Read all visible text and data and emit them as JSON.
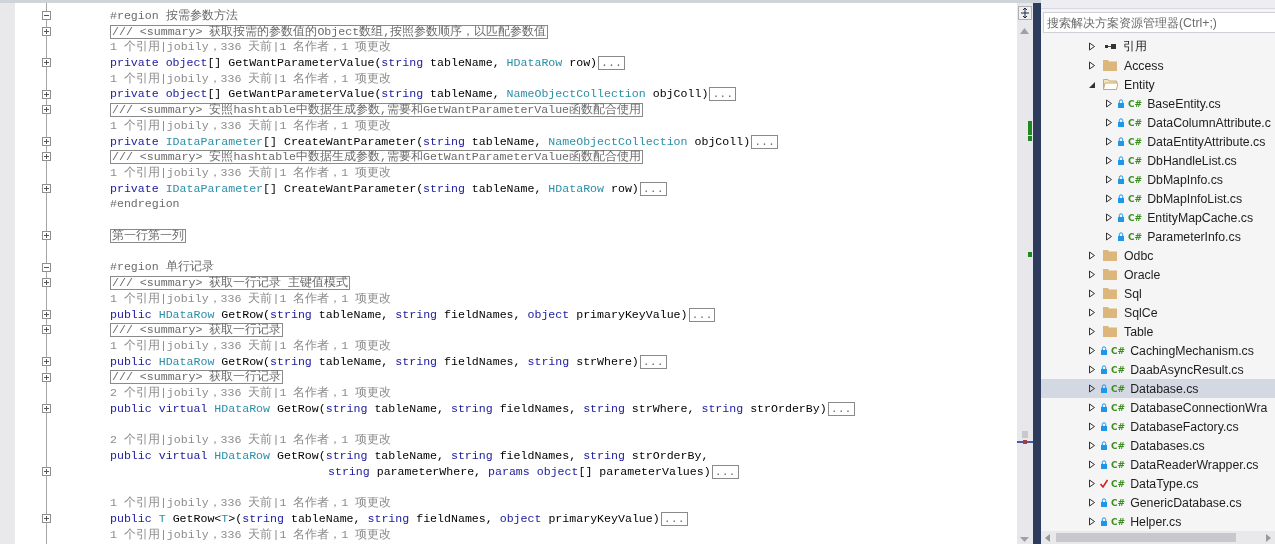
{
  "editor": {
    "lines": [
      {
        "kind": "region",
        "text": "#region 按需参数方法",
        "folded": false
      },
      {
        "kind": "summary",
        "text": "/// <summary> 获取按需的参数值的Object数组,按照参数顺序，以匹配参数值",
        "folded": true
      },
      {
        "kind": "lens",
        "text": "1 个引用|jobily，336 天前|1 名作者，1 项更改"
      },
      {
        "kind": "code",
        "folded": true,
        "ellipsis": "...",
        "tokens": [
          {
            "text": "private object",
            "kind": "keyword"
          },
          {
            "text": "[] GetWantParameterValue(",
            "kind": "plain"
          },
          {
            "text": "string",
            "kind": "keyword"
          },
          {
            "text": " tableName, ",
            "kind": "plain"
          },
          {
            "text": "HDataRow",
            "kind": "type"
          },
          {
            "text": " row)",
            "kind": "plain"
          }
        ]
      },
      {
        "kind": "lens",
        "text": "1 个引用|jobily，336 天前|1 名作者，1 项更改"
      },
      {
        "kind": "code",
        "folded": true,
        "ellipsis": "...",
        "tokens": [
          {
            "text": "private object",
            "kind": "keyword"
          },
          {
            "text": "[] GetWantParameterValue(",
            "kind": "plain"
          },
          {
            "text": "string",
            "kind": "keyword"
          },
          {
            "text": " tableName, ",
            "kind": "plain"
          },
          {
            "text": "NameObjectCollection",
            "kind": "type"
          },
          {
            "text": " objColl)",
            "kind": "plain"
          }
        ]
      },
      {
        "kind": "summary",
        "text": "/// <summary> 安照hashtable中数据生成参数,需要和GetWantParameterValue函数配合使用",
        "folded": true
      },
      {
        "kind": "lens",
        "text": "1 个引用|jobily，336 天前|1 名作者，1 项更改"
      },
      {
        "kind": "code",
        "folded": true,
        "ellipsis": "...",
        "tokens": [
          {
            "text": "private",
            "kind": "keyword"
          },
          {
            "text": " IDataParameter",
            "kind": "type"
          },
          {
            "text": "[] CreateWantParameter(",
            "kind": "plain"
          },
          {
            "text": "string",
            "kind": "keyword"
          },
          {
            "text": " tableName, ",
            "kind": "plain"
          },
          {
            "text": "NameObjectCollection",
            "kind": "type"
          },
          {
            "text": " objColl)",
            "kind": "plain"
          }
        ]
      },
      {
        "kind": "summary",
        "text": "/// <summary> 安照hashtable中数据生成参数,需要和GetWantParameterValue函数配合使用",
        "folded": true
      },
      {
        "kind": "lens",
        "text": "1 个引用|jobily，336 天前|1 名作者，1 项更改"
      },
      {
        "kind": "code",
        "folded": true,
        "ellipsis": "...",
        "tokens": [
          {
            "text": "private",
            "kind": "keyword"
          },
          {
            "text": " IDataParameter",
            "kind": "type"
          },
          {
            "text": "[] CreateWantParameter(",
            "kind": "plain"
          },
          {
            "text": "string",
            "kind": "keyword"
          },
          {
            "text": " tableName, ",
            "kind": "plain"
          },
          {
            "text": "HDataRow",
            "kind": "type"
          },
          {
            "text": " row)",
            "kind": "plain"
          }
        ]
      },
      {
        "kind": "endregion",
        "text": "#endregion"
      },
      {
        "kind": "blank"
      },
      {
        "kind": "summary",
        "text": "第一行第一列",
        "folded": true
      },
      {
        "kind": "blank"
      },
      {
        "kind": "region",
        "text": "#region 单行记录",
        "folded": false
      },
      {
        "kind": "summary",
        "text": "/// <summary> 获取一行记录 主键值模式",
        "folded": true
      },
      {
        "kind": "lens",
        "text": "1 个引用|jobily，336 天前|1 名作者，1 项更改"
      },
      {
        "kind": "code",
        "folded": true,
        "ellipsis": "...",
        "tokens": [
          {
            "text": "public",
            "kind": "keyword"
          },
          {
            "text": " HDataRow",
            "kind": "type"
          },
          {
            "text": " GetRow(",
            "kind": "plain"
          },
          {
            "text": "string",
            "kind": "keyword"
          },
          {
            "text": " tableName, ",
            "kind": "plain"
          },
          {
            "text": "string",
            "kind": "keyword"
          },
          {
            "text": " fieldNames, ",
            "kind": "plain"
          },
          {
            "text": "object",
            "kind": "keyword"
          },
          {
            "text": " primaryKeyValue)",
            "kind": "plain"
          }
        ]
      },
      {
        "kind": "summary",
        "text": "/// <summary> 获取一行记录",
        "folded": true
      },
      {
        "kind": "lens",
        "text": "1 个引用|jobily，336 天前|1 名作者，1 项更改"
      },
      {
        "kind": "code",
        "folded": true,
        "ellipsis": "...",
        "tokens": [
          {
            "text": "public",
            "kind": "keyword"
          },
          {
            "text": " HDataRow",
            "kind": "type"
          },
          {
            "text": " GetRow(",
            "kind": "plain"
          },
          {
            "text": "string",
            "kind": "keyword"
          },
          {
            "text": " tableName, ",
            "kind": "plain"
          },
          {
            "text": "string",
            "kind": "keyword"
          },
          {
            "text": " fieldNames, ",
            "kind": "plain"
          },
          {
            "text": "string",
            "kind": "keyword"
          },
          {
            "text": " strWhere)",
            "kind": "plain"
          }
        ]
      },
      {
        "kind": "summary",
        "text": "/// <summary> 获取一行记录",
        "folded": true
      },
      {
        "kind": "lens",
        "text": "2 个引用|jobily，336 天前|1 名作者，1 项更改"
      },
      {
        "kind": "code",
        "folded": true,
        "ellipsis": "...",
        "tokens": [
          {
            "text": "public virtual",
            "kind": "keyword"
          },
          {
            "text": " HDataRow",
            "kind": "type"
          },
          {
            "text": " GetRow(",
            "kind": "plain"
          },
          {
            "text": "string",
            "kind": "keyword"
          },
          {
            "text": " tableName, ",
            "kind": "plain"
          },
          {
            "text": "string",
            "kind": "keyword"
          },
          {
            "text": " fieldNames, ",
            "kind": "plain"
          },
          {
            "text": "string",
            "kind": "keyword"
          },
          {
            "text": " strWhere, ",
            "kind": "plain"
          },
          {
            "text": "string",
            "kind": "keyword"
          },
          {
            "text": " strOrderBy)",
            "kind": "plain"
          }
        ]
      },
      {
        "kind": "blank"
      },
      {
        "kind": "lens",
        "text": "2 个引用|jobily，336 天前|1 名作者，1 项更改"
      },
      {
        "kind": "code",
        "tokens": [
          {
            "text": "public virtual",
            "kind": "keyword"
          },
          {
            "text": " HDataRow",
            "kind": "type"
          },
          {
            "text": " GetRow(",
            "kind": "plain"
          },
          {
            "text": "string",
            "kind": "keyword"
          },
          {
            "text": " tableName, ",
            "kind": "plain"
          },
          {
            "text": "string",
            "kind": "keyword"
          },
          {
            "text": " fieldNames, ",
            "kind": "plain"
          },
          {
            "text": "string",
            "kind": "keyword"
          },
          {
            "text": " strOrderBy,",
            "kind": "plain"
          }
        ]
      },
      {
        "kind": "code",
        "continuation": true,
        "folded": true,
        "ellipsis": "...",
        "tokens": [
          {
            "text": "string",
            "kind": "keyword"
          },
          {
            "text": " parameterWhere, ",
            "kind": "plain"
          },
          {
            "text": "params object",
            "kind": "keyword"
          },
          {
            "text": "[] parameterValues)",
            "kind": "plain"
          }
        ]
      },
      {
        "kind": "blank"
      },
      {
        "kind": "lens",
        "text": "1 个引用|jobily，336 天前|1 名作者，1 项更改"
      },
      {
        "kind": "code",
        "folded": true,
        "ellipsis": "...",
        "tokens": [
          {
            "text": "public",
            "kind": "keyword"
          },
          {
            "text": " T",
            "kind": "type"
          },
          {
            "text": " GetRow<",
            "kind": "plain"
          },
          {
            "text": "T",
            "kind": "type"
          },
          {
            "text": ">(",
            "kind": "plain"
          },
          {
            "text": "string",
            "kind": "keyword"
          },
          {
            "text": " tableName, ",
            "kind": "plain"
          },
          {
            "text": "string",
            "kind": "keyword"
          },
          {
            "text": " fieldNames, ",
            "kind": "plain"
          },
          {
            "text": "object",
            "kind": "keyword"
          },
          {
            "text": " primaryKeyValue)",
            "kind": "plain"
          }
        ]
      },
      {
        "kind": "lens",
        "text": "1 个引用|jobily，336 天前|1 名作者，1 项更改"
      }
    ]
  },
  "solution_explorer": {
    "search": {
      "placeholder": "搜索解决方案资源管理器(Ctrl+;)"
    },
    "tree": [
      {
        "label": "引用",
        "kind": "references",
        "expanded": false,
        "selected": false
      },
      {
        "label": "Access",
        "kind": "folder",
        "expanded": false,
        "selected": false
      },
      {
        "label": "Entity",
        "kind": "folder",
        "expanded": true,
        "selected": false,
        "children": [
          {
            "label": "BaseEntity.cs",
            "kind": "csfile",
            "badge": "C#",
            "checked_out": false,
            "expanded": false,
            "selected": false
          },
          {
            "label": "DataColumnAttribute.c",
            "kind": "csfile",
            "badge": "C#",
            "checked_out": false,
            "expanded": false,
            "selected": false
          },
          {
            "label": "DataEntityAttribute.cs",
            "kind": "csfile",
            "badge": "C#",
            "checked_out": false,
            "expanded": false,
            "selected": false
          },
          {
            "label": "DbHandleList.cs",
            "kind": "csfile",
            "badge": "C#",
            "checked_out": false,
            "expanded": false,
            "selected": false
          },
          {
            "label": "DbMapInfo.cs",
            "kind": "csfile",
            "badge": "C#",
            "checked_out": false,
            "expanded": false,
            "selected": false
          },
          {
            "label": "DbMapInfoList.cs",
            "kind": "csfile",
            "badge": "C#",
            "checked_out": false,
            "expanded": false,
            "selected": false
          },
          {
            "label": "EntityMapCache.cs",
            "kind": "csfile",
            "badge": "C#",
            "checked_out": false,
            "expanded": false,
            "selected": false
          },
          {
            "label": "ParameterInfo.cs",
            "kind": "csfile",
            "badge": "C#",
            "checked_out": false,
            "expanded": false,
            "selected": false
          }
        ]
      },
      {
        "label": "Odbc",
        "kind": "folder",
        "expanded": false,
        "selected": false
      },
      {
        "label": "Oracle",
        "kind": "folder",
        "expanded": false,
        "selected": false
      },
      {
        "label": "Sql",
        "kind": "folder",
        "expanded": false,
        "selected": false
      },
      {
        "label": "SqlCe",
        "kind": "folder",
        "expanded": false,
        "selected": false
      },
      {
        "label": "Table",
        "kind": "folder",
        "expanded": false,
        "selected": false
      },
      {
        "label": "CachingMechanism.cs",
        "kind": "csfile",
        "badge": "C#",
        "checked_out": false,
        "expanded": false,
        "selected": false
      },
      {
        "label": "DaabAsyncResult.cs",
        "kind": "csfile",
        "badge": "C#",
        "checked_out": false,
        "expanded": false,
        "selected": false
      },
      {
        "label": "Database.cs",
        "kind": "csfile",
        "badge": "C#",
        "checked_out": false,
        "expanded": false,
        "selected": true
      },
      {
        "label": "DatabaseConnectionWra",
        "kind": "csfile",
        "badge": "C#",
        "checked_out": false,
        "expanded": false,
        "selected": false
      },
      {
        "label": "DatabaseFactory.cs",
        "kind": "csfile",
        "badge": "C#",
        "checked_out": false,
        "expanded": false,
        "selected": false
      },
      {
        "label": "Databases.cs",
        "kind": "csfile",
        "badge": "C#",
        "checked_out": false,
        "expanded": false,
        "selected": false
      },
      {
        "label": "DataReaderWrapper.cs",
        "kind": "csfile",
        "badge": "C#",
        "checked_out": false,
        "expanded": false,
        "selected": false
      },
      {
        "label": "DataType.cs",
        "kind": "csfile",
        "badge": "C#",
        "checked_out": true,
        "expanded": false,
        "selected": false
      },
      {
        "label": "GenericDatabase.cs",
        "kind": "csfile",
        "badge": "C#",
        "checked_out": false,
        "expanded": false,
        "selected": false
      },
      {
        "label": "Helper.cs",
        "kind": "csfile",
        "badge": "C#",
        "checked_out": false,
        "expanded": false,
        "selected": false
      }
    ]
  }
}
